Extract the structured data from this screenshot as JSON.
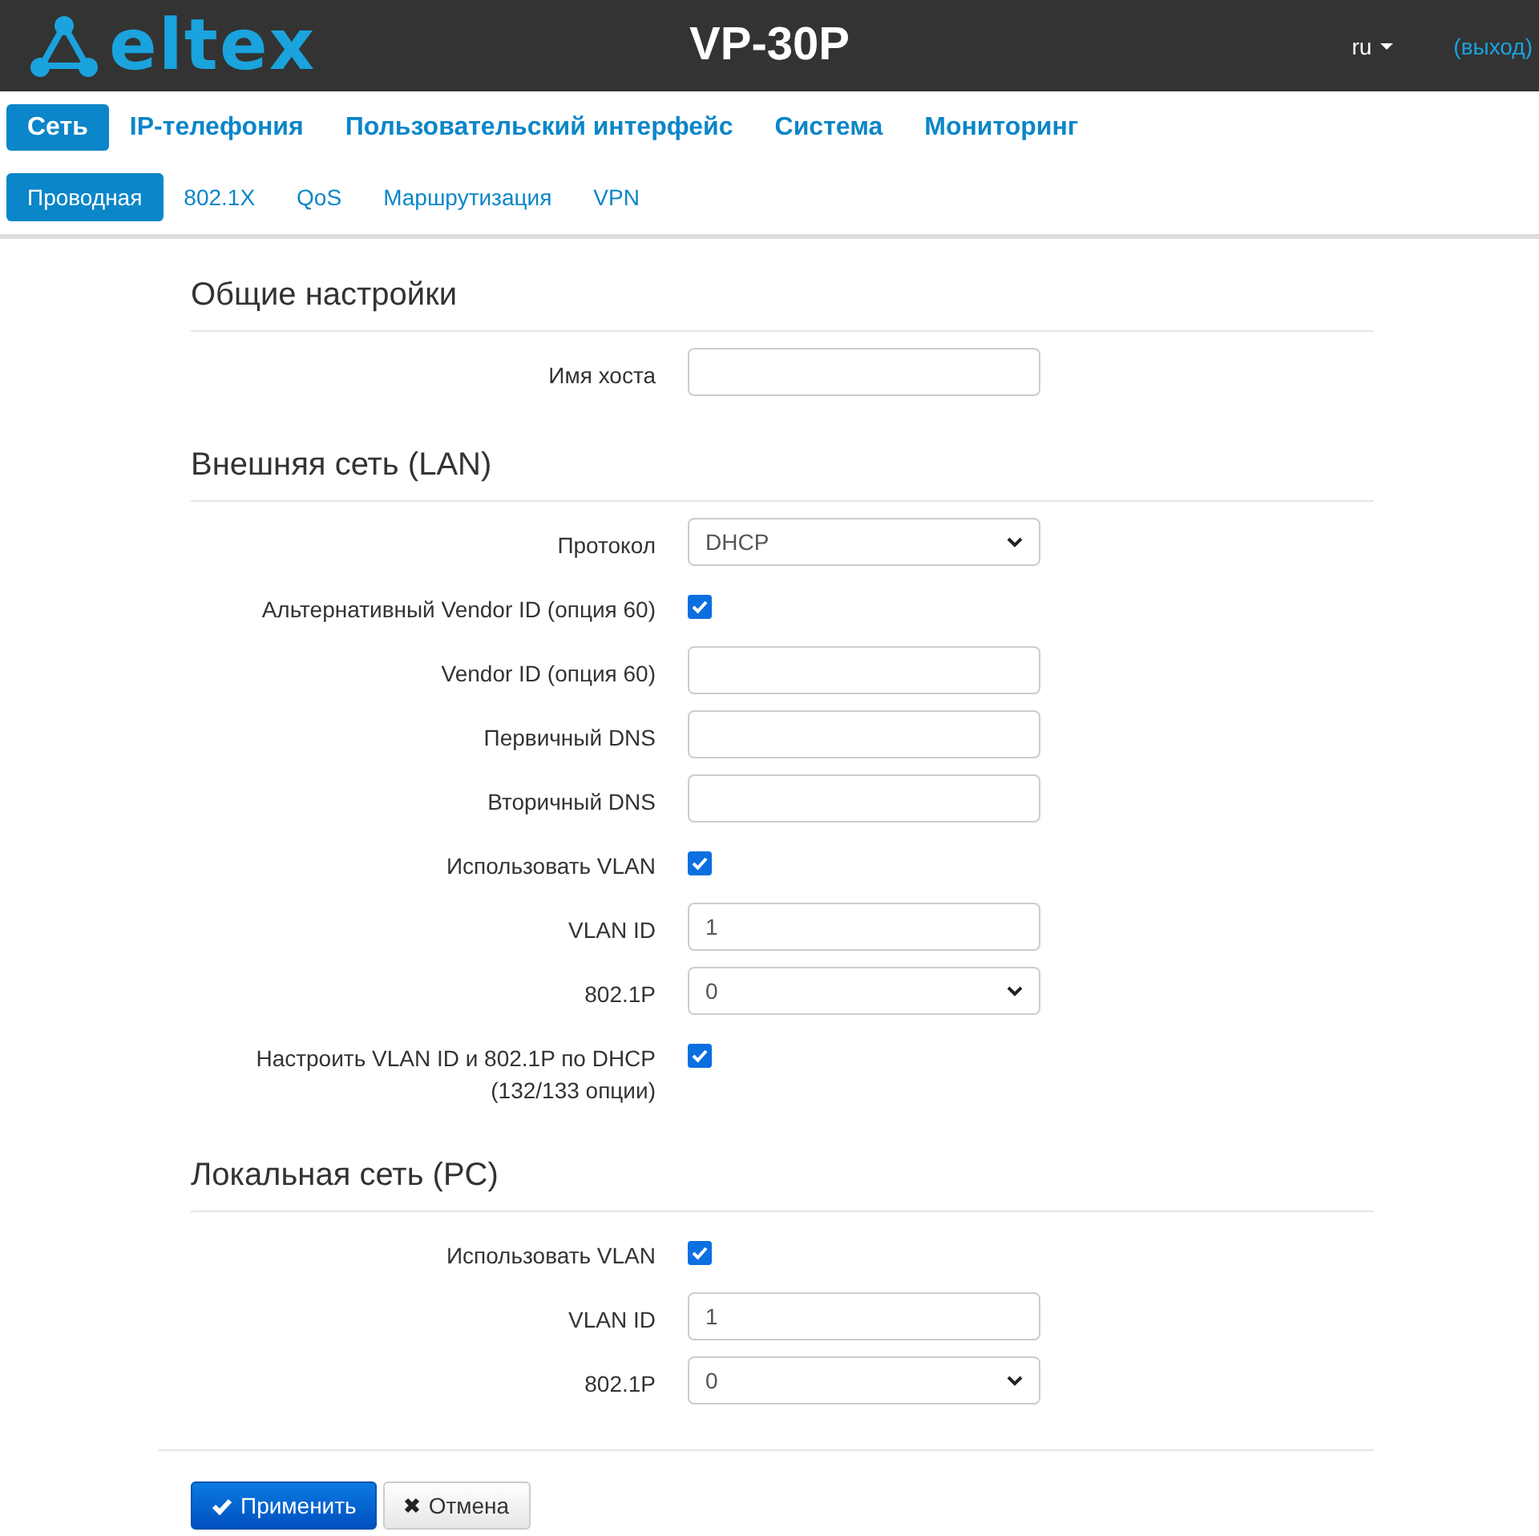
{
  "header": {
    "logo": "eltex",
    "title": "VP-30P",
    "language": "ru",
    "logout": "(выход)"
  },
  "nav": [
    {
      "label": "Сеть",
      "selected": true
    },
    {
      "label": "IP-телефония",
      "selected": false
    },
    {
      "label": "Пользовательский интерфейс",
      "selected": false
    },
    {
      "label": "Система",
      "selected": false
    },
    {
      "label": "Мониторинг",
      "selected": false
    }
  ],
  "subnav": [
    {
      "label": "Проводная",
      "selected": true
    },
    {
      "label": "802.1X",
      "selected": false
    },
    {
      "label": "QoS",
      "selected": false
    },
    {
      "label": "Маршрутизация",
      "selected": false
    },
    {
      "label": "VPN",
      "selected": false
    }
  ],
  "sections": [
    {
      "title": "Общие настройки",
      "fields": [
        {
          "kind": "text",
          "label": "Имя хоста"
        }
      ]
    },
    {
      "title": "Внешняя сеть (LAN)",
      "fields": [
        {
          "kind": "select",
          "label": "Протокол",
          "value": "DHCP"
        },
        {
          "kind": "checkbox",
          "label": "Альтернативный Vendor ID (опция 60)",
          "checked": true
        },
        {
          "kind": "text",
          "label": "Vendor ID (опция 60)"
        },
        {
          "kind": "text",
          "label": "Первичный DNS"
        },
        {
          "kind": "text",
          "label": "Вторичный DNS"
        },
        {
          "kind": "checkbox",
          "label": "Использовать VLAN",
          "checked": true
        },
        {
          "kind": "text",
          "label": "VLAN ID",
          "value": "1"
        },
        {
          "kind": "select",
          "label": "802.1P",
          "value": "0"
        },
        {
          "kind": "checkbox",
          "label": "Настроить VLAN ID и 802.1P по DHCP (132/133 опции)",
          "checked": true
        }
      ]
    },
    {
      "title": "Локальная сеть (PC)",
      "fields": [
        {
          "kind": "checkbox",
          "label": "Использовать VLAN",
          "checked": true
        },
        {
          "kind": "text",
          "label": "VLAN ID",
          "value": "1"
        },
        {
          "kind": "select",
          "label": "802.1P",
          "value": "0"
        }
      ]
    }
  ],
  "buttons": [
    {
      "kind": "apply",
      "label": "Применить"
    },
    {
      "kind": "cancel",
      "label": "Отмена"
    }
  ]
}
